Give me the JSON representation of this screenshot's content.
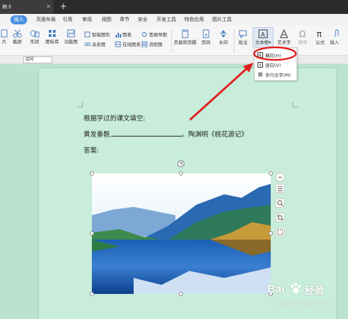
{
  "tabbar": {
    "doc_tab": "稿卡",
    "close": "✕",
    "add": "+"
  },
  "menu": [
    "插入",
    "页面布局",
    "引用",
    "审阅",
    "视图",
    "章节",
    "安全",
    "开发工具",
    "特色应用",
    "图片工具"
  ],
  "ribbon": {
    "partial_left": "片",
    "screenshot": "截屏",
    "shapes": "形状",
    "icon_lib": "图标库",
    "func_chart": "功能图",
    "smart_art": "智能图形",
    "chart": "图表",
    "mind_map": "思维导图",
    "relation": "关系图",
    "online_chart": "在线图表",
    "flowchart": "流程图",
    "header_footer": "页眉和页脚",
    "page_number": "页码",
    "watermark": "水印",
    "comment": "批注",
    "textbox": "文本框",
    "art_text": "艺术字",
    "symbol": "符号",
    "formula": "公式",
    "insert_attach": "插入"
  },
  "format": {
    "font_size": "四号"
  },
  "textbox_menu": {
    "horizontal": "横向(H)",
    "vertical": "竖向(V)",
    "multiline": "多行文字(M)"
  },
  "document": {
    "line1": "根据学过的课文填空:",
    "line2_before": "黄发垂髫,",
    "line2_after": "。陶渊明《桃花源记》",
    "line3": "答案:"
  },
  "watermark": {
    "brand_text": "Bai",
    "brand_cn": "经验",
    "url": "jingyan.baidu.com"
  },
  "colors": {
    "accent": "#4a90e2",
    "page_bg": "#c8eddb",
    "arrow": "#e02020"
  }
}
